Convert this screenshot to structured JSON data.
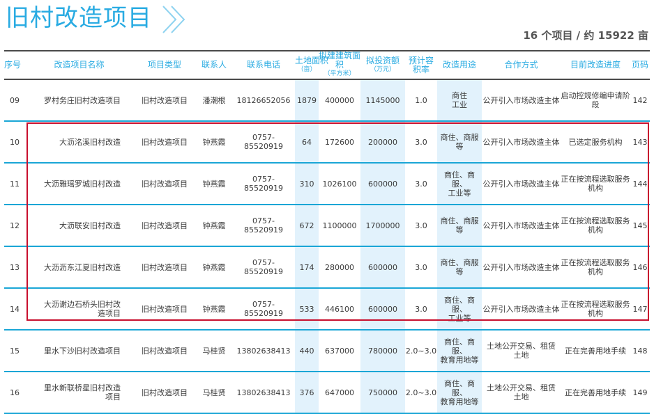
{
  "header": {
    "title": "旧村改造项目",
    "summary": "16 个项目 / 约 15922 亩"
  },
  "accent_color": "#29abe2",
  "highlight_box_color": "#c8102e",
  "columns": {
    "seq": "序号",
    "name": "改造项目名称",
    "type": "项目类型",
    "contact": "联系人",
    "phone": "联系电话",
    "land_area": "土地面积",
    "land_area_unit": "（亩）",
    "build_area": "拟建建筑面积",
    "build_area_unit": "（平方米）",
    "investment": "拟投资额",
    "investment_unit": "（万元）",
    "plot_ratio": "预计容积率",
    "usage": "改造用途",
    "coop": "合作方式",
    "progress": "目前改造进度",
    "page": "页码"
  },
  "rows": [
    {
      "seq": "09",
      "name": "罗村务庄旧村改造项目",
      "type": "旧村改造项目",
      "contact": "潘潮根",
      "phone": "18126652056",
      "land": "1879",
      "build": "400000",
      "invest": "1145000",
      "ratio": "1.0",
      "usage": "商住\n工业",
      "coop": "公开引入市场改造主体",
      "progress": "启动控规修编申请阶段",
      "page": "142"
    },
    {
      "seq": "10",
      "name": "大沥洺溪旧村改造",
      "type": "旧村改造项目",
      "contact": "钟燕霞",
      "phone": "0757-\n85520919",
      "land": "64",
      "build": "172600",
      "invest": "200000",
      "ratio": "3.0",
      "usage": "商住、商服\n等",
      "coop": "公开引入市场改造主体",
      "progress": "已选定服务机构",
      "page": "143"
    },
    {
      "seq": "11",
      "name": "大沥雅瑶罗城旧村改造",
      "type": "旧村改造项目",
      "contact": "钟燕霞",
      "phone": "0757-\n85520919",
      "land": "310",
      "build": "1026100",
      "invest": "600000",
      "ratio": "3.0",
      "usage": "商住、商服、\n工业等",
      "coop": "公开引入市场改造主体",
      "progress": "正在按流程选取服务机构",
      "page": "144"
    },
    {
      "seq": "12",
      "name": "大沥联安旧村改造",
      "type": "旧村改造项目",
      "contact": "钟燕霞",
      "phone": "0757-\n85520919",
      "land": "672",
      "build": "1100000",
      "invest": "1700000",
      "ratio": "3.0",
      "usage": "商住、商服\n等",
      "coop": "公开引入市场改造主体",
      "progress": "正在按流程选取服务机构",
      "page": "145"
    },
    {
      "seq": "13",
      "name": "大沥沥东江夏旧村改造",
      "type": "旧村改造项目",
      "contact": "钟燕霞",
      "phone": "0757-\n85520919",
      "land": "174",
      "build": "280000",
      "invest": "600000",
      "ratio": "3.0",
      "usage": "商住、商服\n等",
      "coop": "公开引入市场改造主体",
      "progress": "正在按流程选取服务机构",
      "page": "146"
    },
    {
      "seq": "14",
      "name": "大沥谢边石桥头旧村改\n造项目",
      "type": "旧村改造项目",
      "contact": "钟燕霞",
      "phone": "0757-\n85520919",
      "land": "533",
      "build": "446100",
      "invest": "600000",
      "ratio": "3.0",
      "usage": "商住、商服、\n工业等",
      "coop": "公开引入市场改造主体",
      "progress": "正在按流程选取服务机构",
      "page": "147"
    },
    {
      "seq": "15",
      "name": "里水下沙旧村改造项目",
      "type": "旧村改造项目",
      "contact": "马桂贤",
      "phone": "13802638413",
      "land": "440",
      "build": "637000",
      "invest": "780000",
      "ratio": "2.0~3.0",
      "usage": "商住、商服、\n教育用地等",
      "coop": "土地公开交易、租赁\n土地",
      "progress": "正在完善用地手续",
      "page": "148"
    },
    {
      "seq": "16",
      "name": "里水新联桥星旧村改造\n项目",
      "type": "旧村改造项目",
      "contact": "马桂贤",
      "phone": "13802638413",
      "land": "376",
      "build": "647000",
      "invest": "750000",
      "ratio": "2.0~3.0",
      "usage": "商住、商服、\n教育用地等",
      "coop": "土地公开交易、租赁\n土地",
      "progress": "正在完善用地手续",
      "page": "149"
    }
  ]
}
